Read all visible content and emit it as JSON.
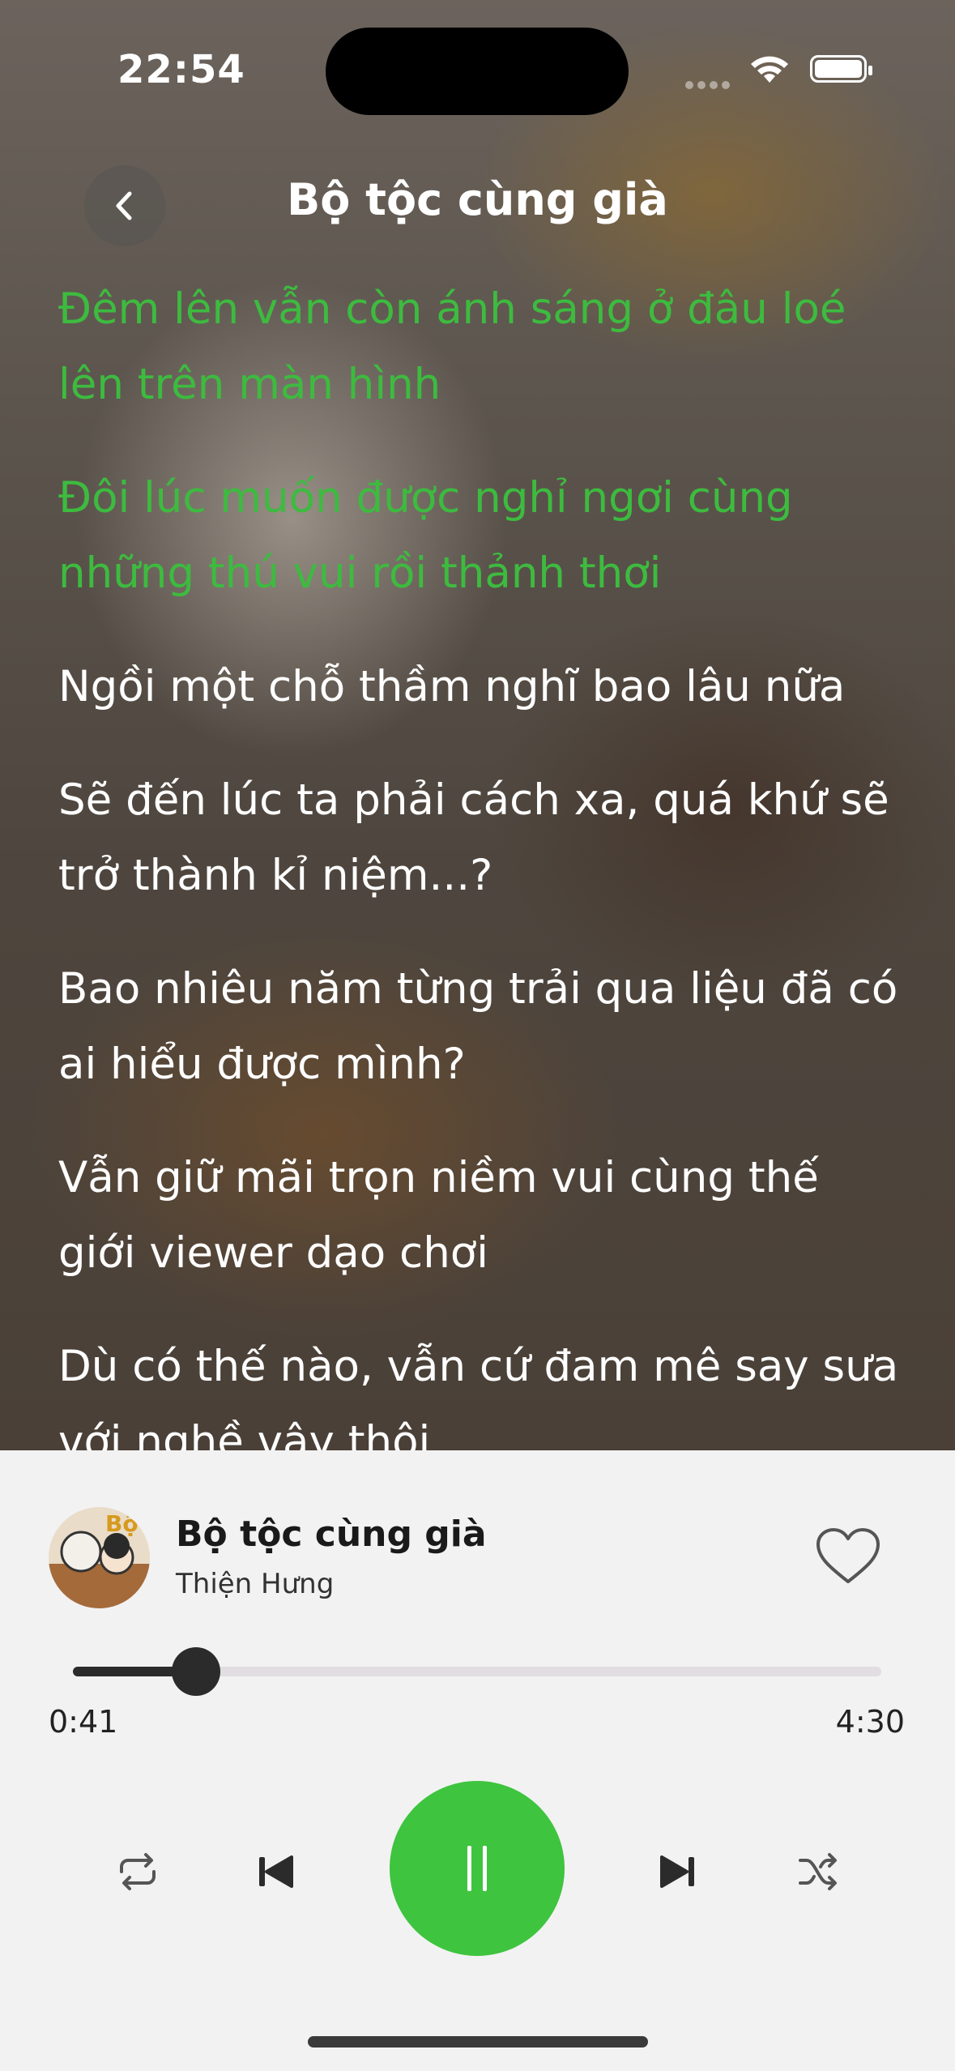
{
  "status_bar": {
    "time": "22:54"
  },
  "header": {
    "title": "Bộ tộc cùng già"
  },
  "lyrics": [
    {
      "text": "Đêm lên vẫn còn ánh sáng ở đâu loé lên trên màn hình",
      "state": "past"
    },
    {
      "text": "Đôi lúc muốn được nghỉ ngơi cùng những thú vui rồi thảnh thơi",
      "state": "past"
    },
    {
      "text": "Ngồi một chỗ thầm nghĩ bao lâu nữa",
      "state": "upcoming"
    },
    {
      "text": "Sẽ đến lúc ta phải cách xa, quá khứ sẽ trở thành kỉ niệm...?",
      "state": "upcoming"
    },
    {
      "text": "Bao nhiêu năm từng trải qua liệu đã có ai hiểu được mình?",
      "state": "upcoming"
    },
    {
      "text": "Vẫn giữ mãi trọn niềm vui cùng thế giới viewer dạo chơi",
      "state": "upcoming"
    },
    {
      "text": "Dù có thế nào, vẫn cứ đam mê say sưa với nghề vậy thôi",
      "state": "upcoming"
    }
  ],
  "player": {
    "song_title": "Bộ tộc cùng già",
    "artist": "Thiện Hưng",
    "elapsed": "0:41",
    "duration": "4:30",
    "progress_fraction": 0.152,
    "liked": false,
    "playing": true
  },
  "icons": {
    "back": "chevron-left-icon",
    "like": "heart-outline-icon",
    "repeat": "repeat-icon",
    "previous": "skip-previous-icon",
    "play_pause": "pause-icon",
    "next": "skip-next-icon",
    "shuffle": "shuffle-icon"
  },
  "colors": {
    "accent": "#3ec43e",
    "lyric_past": "#3dbb3f",
    "lyric_upcoming": "#ffffff",
    "player_bg": "#f2f2f2"
  }
}
